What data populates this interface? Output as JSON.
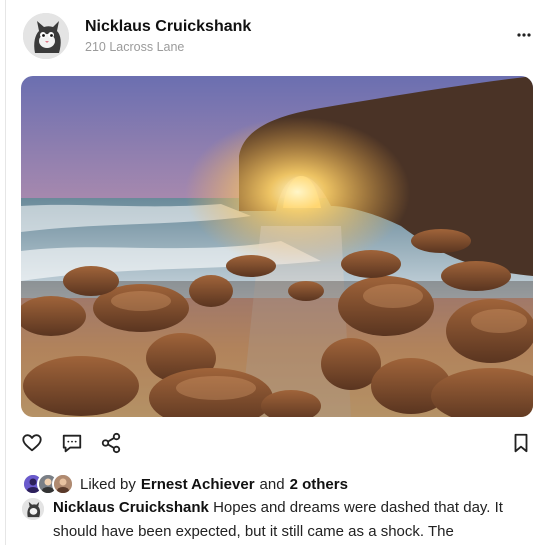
{
  "post": {
    "author_name": "Nicklaus Cruickshank",
    "location": "210 Lacross Lane",
    "likes": {
      "prefix": "Liked by",
      "user": "Ernest Achiever",
      "joiner": "and",
      "others": "2 others"
    },
    "caption": {
      "author": "Nicklaus Cruickshank",
      "text": "Hopes and dreams were dashed that day. It should have been expected, but it still came as a shock. The"
    }
  },
  "icons": {
    "more": "more-horizontal-icon",
    "like": "heart-icon",
    "comment": "comment-icon",
    "share": "share-icon",
    "save": "bookmark-icon"
  }
}
